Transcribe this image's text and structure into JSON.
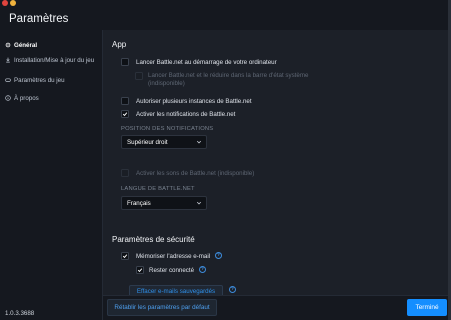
{
  "window": {
    "title": "Paramètres"
  },
  "sidebar": {
    "items": [
      {
        "label": "Général",
        "icon": "gear-icon",
        "active": true
      },
      {
        "label": "Installation/Mise à jour du jeu",
        "icon": "download-icon"
      },
      {
        "label": "Paramètres du jeu",
        "icon": "gamepad-icon"
      },
      {
        "label": "À propos",
        "icon": "info-icon"
      }
    ],
    "version": "1.0.3.3688"
  },
  "app": {
    "title": "App",
    "launch_startup": "Lancer Battle.net au démarrage de votre ordinateur",
    "launch_minimized": "Lancer Battle.net et le réduire dans la barre d'état système (indisponible)",
    "multiple_instances": "Autoriser plusieurs instances de Battle.net",
    "notifications": "Activer les notifications de Battle.net",
    "notification_position_caption": "POSITION DES NOTIFICATIONS",
    "notification_position_value": "Supérieur droit",
    "sounds": "Activer les sons de Battle.net (indisponible)",
    "language_caption": "LANGUE DE BATTLE.NET",
    "language_value": "Français"
  },
  "security": {
    "title": "Paramètres de sécurité",
    "remember_email": "Mémoriser l'adresse e-mail",
    "stay_connected": "Rester connecté",
    "help_symbol": "?",
    "clear_emails": "Effacer e-mails sauvegardés"
  },
  "footer": {
    "reset": "Rétablir les paramètres par défaut",
    "done": "Terminé"
  },
  "colors": {
    "accent": "#148eff",
    "link": "#4ea0f0",
    "background": "#1c2028",
    "sidebar": "#15181f"
  }
}
